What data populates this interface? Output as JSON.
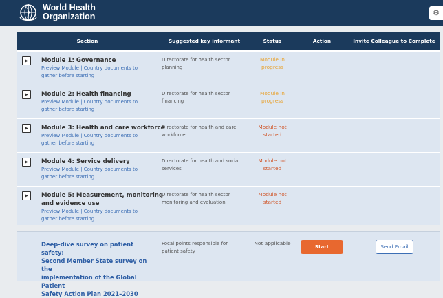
{
  "header": {
    "logo_line1": "World Health",
    "logo_line2": "Organization",
    "settings_icon": "gear-icon"
  },
  "table": {
    "columns": [
      "Section",
      "Suggested key informant",
      "Status",
      "Action",
      "Invite Colleague to Complete"
    ],
    "rows": [
      {
        "title": "Module 1: Governance",
        "links_line1": "Preview Module | Country documents to",
        "links_line2": "gather before starting",
        "informant_line1": "Directorate for health sector",
        "informant_line2": "planning",
        "status_line1": "Module in",
        "status_line2": "progress"
      },
      {
        "title": "Module 2: Health financing",
        "links_line1": "Preview Module | Country documents to",
        "links_line2": "gather before starting",
        "informant_line1": "Directorate for health sector",
        "informant_line2": "financing",
        "status_line1": "Module in",
        "status_line2": "progress"
      },
      {
        "title": "Module 3: Health and care workforce",
        "links_line1": "Preview Module | Country documents to",
        "links_line2": "gather before starting",
        "informant_line1": "Directorate for health and care",
        "informant_line2": "workforce",
        "status_line1": "Module not",
        "status_line2": "started"
      },
      {
        "title": "Module 4: Service delivery",
        "links_line1": "Preview Module | Country documents to",
        "links_line2": "gather before starting",
        "informant_line1": "Directorate for health and social",
        "informant_line2": "services",
        "status_line1": "Module not",
        "status_line2": "started"
      },
      {
        "title_line1": "Module 5: Measurement, monitoring",
        "title_line2": "and evidence use",
        "links_line1": "Preview Module | Country documents to",
        "links_line2": "gather before starting",
        "informant_line1": "Directorate for health sector",
        "informant_line2": "monitoring and evaluation",
        "status_line1": "Module not",
        "status_line2": "started"
      }
    ]
  },
  "deep_dive": {
    "title_line1": "Deep-dive survey on patient safety:",
    "title_line2": "Second Member State survey on the",
    "title_line3": "implementation of the Global Patient",
    "title_line4": "Safety Action Plan 2021–2030",
    "informant_line1": "Focal points responsible for",
    "informant_line2": "patient safety",
    "status": "Not applicable",
    "start_label": "Start",
    "email_label": "Send Email"
  },
  "colors": {
    "header_bg": "#1b3a5c",
    "row_bg": "#dde6f1",
    "status_in_progress": "#e8a331",
    "status_not_started": "#d0572a",
    "start_button": "#e8682f",
    "link": "#3d6fb5"
  }
}
